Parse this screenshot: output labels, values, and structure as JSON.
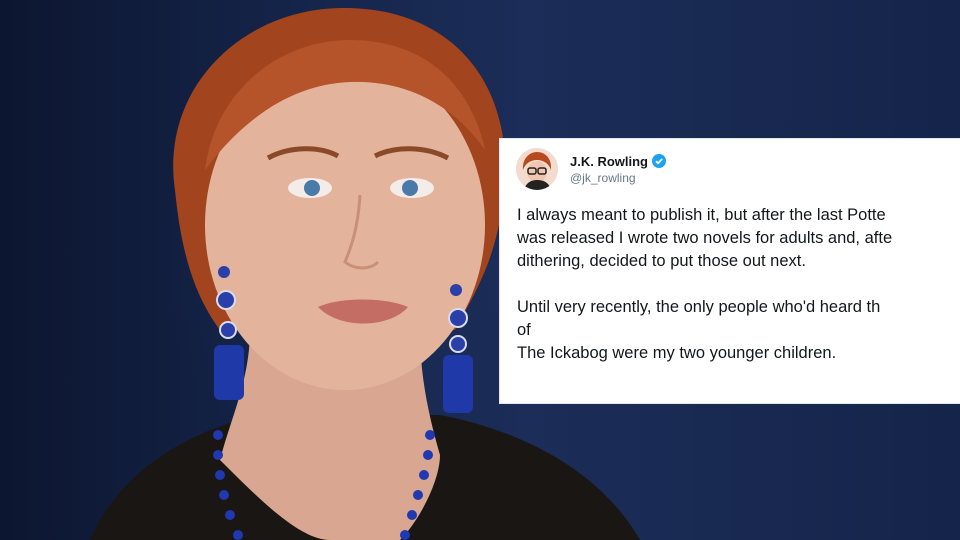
{
  "colors": {
    "background_navy": "#16264d",
    "card": "#ffffff",
    "name_text": "#14171a",
    "handle_text": "#657786",
    "verified": "#1da1f2",
    "hair": "#b5532a",
    "earring_blue": "#1f3aa8"
  },
  "tweet": {
    "display_name": "J.K. Rowling",
    "handle": "@jk_rowling",
    "verified_icon": "verified-badge-icon",
    "paragraphs": [
      {
        "lines": [
          "I always meant to publish it, but after the last Potte",
          "was released I wrote two novels for adults and, afte",
          "dithering, decided to put those out next."
        ]
      },
      {
        "lines": [
          "Until very recently, the only people who'd heard th",
          "of",
          "The Ickabog were my two younger children."
        ]
      }
    ]
  }
}
